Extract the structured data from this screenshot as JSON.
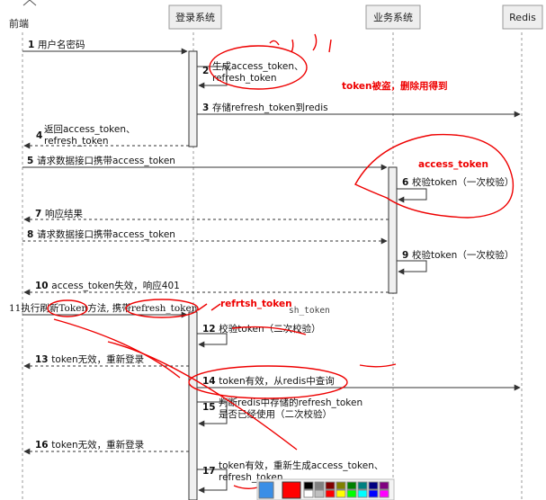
{
  "participants": [
    {
      "id": "frontend",
      "label": "前端"
    },
    {
      "id": "login",
      "label": "登录系统"
    },
    {
      "id": "business",
      "label": "业务系统"
    },
    {
      "id": "redis",
      "label": "Redis"
    }
  ],
  "messages": [
    {
      "n": "1",
      "text": "用户名密码"
    },
    {
      "n": "2",
      "line1": "生成access_token、",
      "line2": "refresh_token"
    },
    {
      "n": "3",
      "text": "存储refresh_token到redis"
    },
    {
      "n": "4",
      "line1": "返回access_token、",
      "line2": "refresh_token"
    },
    {
      "n": "5",
      "text": "请求数据接口携带access_token"
    },
    {
      "n": "6",
      "text": "校验token（一次校验）"
    },
    {
      "n": "7",
      "text": "响应结果"
    },
    {
      "n": "8",
      "text": "请求数据接口携带access_token"
    },
    {
      "n": "9",
      "text": "校验token（一次校验）"
    },
    {
      "n": "10",
      "text": "access_token失效，响应401"
    },
    {
      "n": "11",
      "text": "11执行刷新Token方法, 携带refresh_token"
    },
    {
      "n": "12",
      "text": "校验token（二次校验）"
    },
    {
      "n": "13",
      "text": "token无效，重新登录"
    },
    {
      "n": "14",
      "text": "token有效，从redis中查询"
    },
    {
      "n": "15",
      "line1": "判断redis中存储的refresh_token",
      "line2": "是否已经使用（二次校验）"
    },
    {
      "n": "16",
      "text": "token无效，重新登录"
    },
    {
      "n": "17",
      "line1": "token有效，重新生成access_token、",
      "line2": "refresh_token"
    }
  ],
  "annotations": {
    "stolen_note": "token被盗，删除用得到",
    "access_token_note": "access_token",
    "refresh_token_note": "refrtsh_token",
    "sh_token_note": "sh_token"
  },
  "colors": {
    "annotation_red": "#e00000",
    "line": "#333333",
    "header_bg": "#eeeeee",
    "activation_bg": "#f0f0f0"
  },
  "palette": {
    "selected": "#ff0000",
    "swatches": [
      "#000000",
      "#808080",
      "#800000",
      "#808000",
      "#008000",
      "#008080",
      "#000080",
      "#800080",
      "#ffffff",
      "#c0c0c0",
      "#ff0000",
      "#ffff00",
      "#00ff00",
      "#00ffff",
      "#0000ff",
      "#ff00ff"
    ]
  }
}
